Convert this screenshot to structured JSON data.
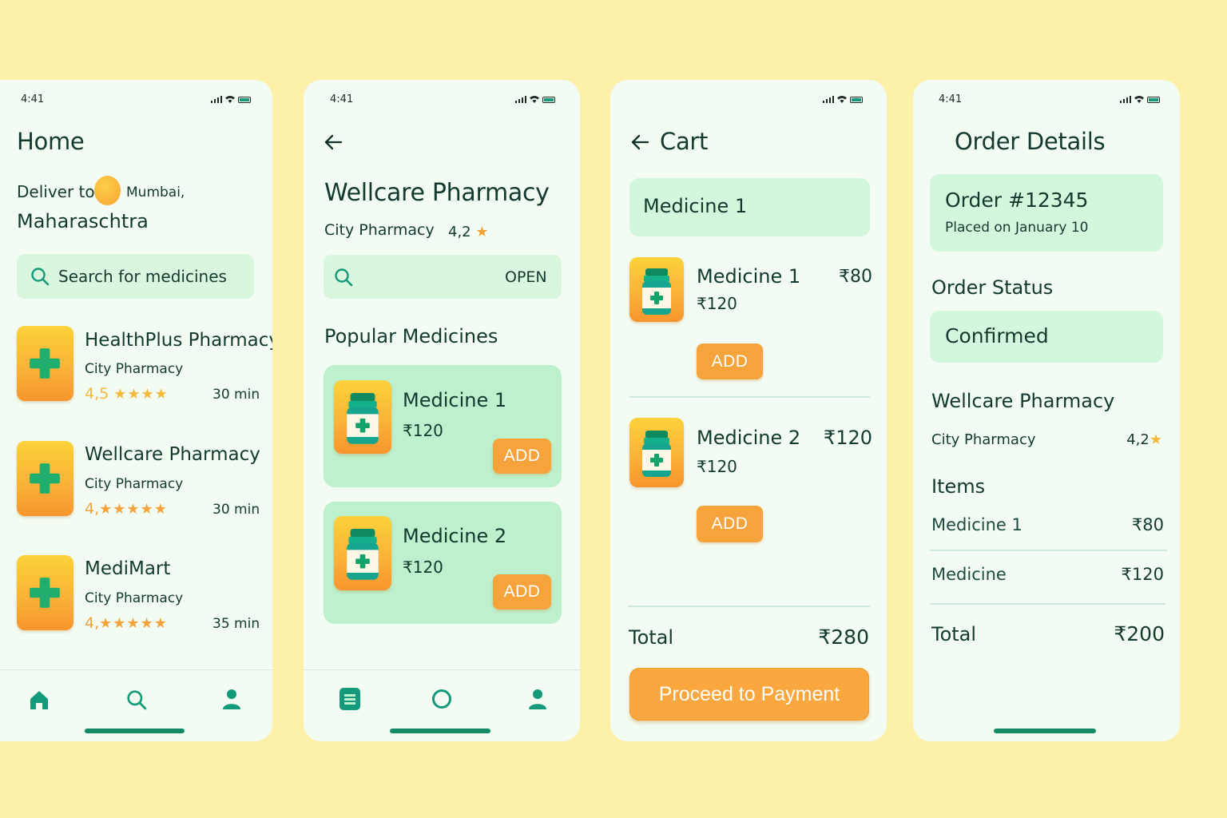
{
  "status_time": "4:41",
  "home": {
    "title": "Home",
    "deliver_label": "Deliver to",
    "location_city": "Mumbai,",
    "location_state": "Maharaschtra",
    "search_placeholder": "Search for medicines",
    "pharmacies": [
      {
        "name": "HealthPlus Pharmacy",
        "type": "City Pharmacy",
        "rating": "4,5",
        "stars": "★★★★",
        "time": "30 min"
      },
      {
        "name": "Wellcare Pharmacy",
        "type": "City Pharmacy",
        "rating": "4,",
        "stars": "★★★★★",
        "time": "30 min"
      },
      {
        "name": "MediMart",
        "type": "City Pharmacy",
        "rating": "4,",
        "stars": "★★★★★",
        "time": "35 min"
      }
    ]
  },
  "pharmacy": {
    "title": "Wellcare Pharmacy",
    "type": "City Pharmacy",
    "rating": "4,2",
    "open_label": "OPEN",
    "section_title": "Popular Medicines",
    "medicines": [
      {
        "name": "Medicine 1",
        "price": "₹120",
        "add_label": "ADD"
      },
      {
        "name": "Medicine 2",
        "price": "₹120",
        "add_label": "ADD"
      }
    ]
  },
  "cart": {
    "title": "Cart",
    "header_item": "Medicine 1",
    "items": [
      {
        "name": "Medicine 1",
        "price": "₹120",
        "line_total": "₹80",
        "add_label": "ADD"
      },
      {
        "name": "Medicine 2",
        "price": "₹120",
        "line_total": "₹120",
        "add_label": "ADD"
      }
    ],
    "total_label": "Total",
    "total_value": "₹280",
    "pay_label": "Proceed to Payment"
  },
  "order": {
    "title": "Order Details",
    "order_id": "Order #12345",
    "placed": "Placed on January 10",
    "status_title": "Order Status",
    "status_value": "Confirmed",
    "pharmacy_name": "Wellcare Pharmacy",
    "pharmacy_type": "City Pharmacy",
    "rating": "4,2",
    "items_title": "Items",
    "items": [
      {
        "name": "Medicine 1",
        "price": "₹80"
      },
      {
        "name": "Medicine",
        "price": "₹120"
      }
    ],
    "total_label": "Total",
    "total_value": "₹200"
  },
  "colors": {
    "accent_green": "#14997a",
    "accent_orange": "#f7a33c",
    "background": "#fdf0a8"
  }
}
